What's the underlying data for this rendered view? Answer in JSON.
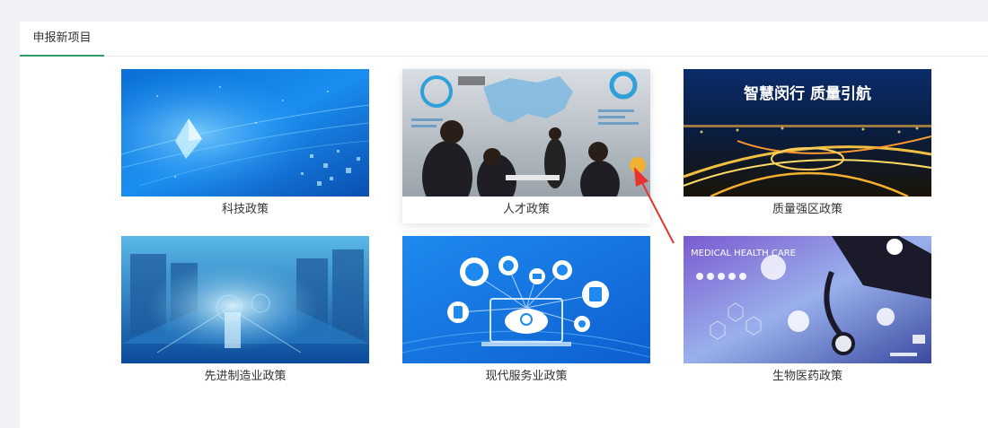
{
  "tabs": [
    {
      "label": "申报新项目",
      "active": true
    }
  ],
  "accent_color": "#2e9c64",
  "cards": [
    {
      "label": "科技政策",
      "image": "tech-network-blue-image"
    },
    {
      "label": "人才政策",
      "image": "business-team-map-image"
    },
    {
      "label": "质量强区政策",
      "image": "night-highway-city-image",
      "banner_text": "智慧闵行 质量引航"
    },
    {
      "label": "先进制造业政策",
      "image": "factory-production-line-image"
    },
    {
      "label": "现代服务业政策",
      "image": "cloud-services-laptop-image"
    },
    {
      "label": "生物医药政策",
      "image": "medical-stethoscope-image",
      "banner_text": "MEDICAL HEALTH CARE"
    }
  ],
  "hovered_card": 1
}
